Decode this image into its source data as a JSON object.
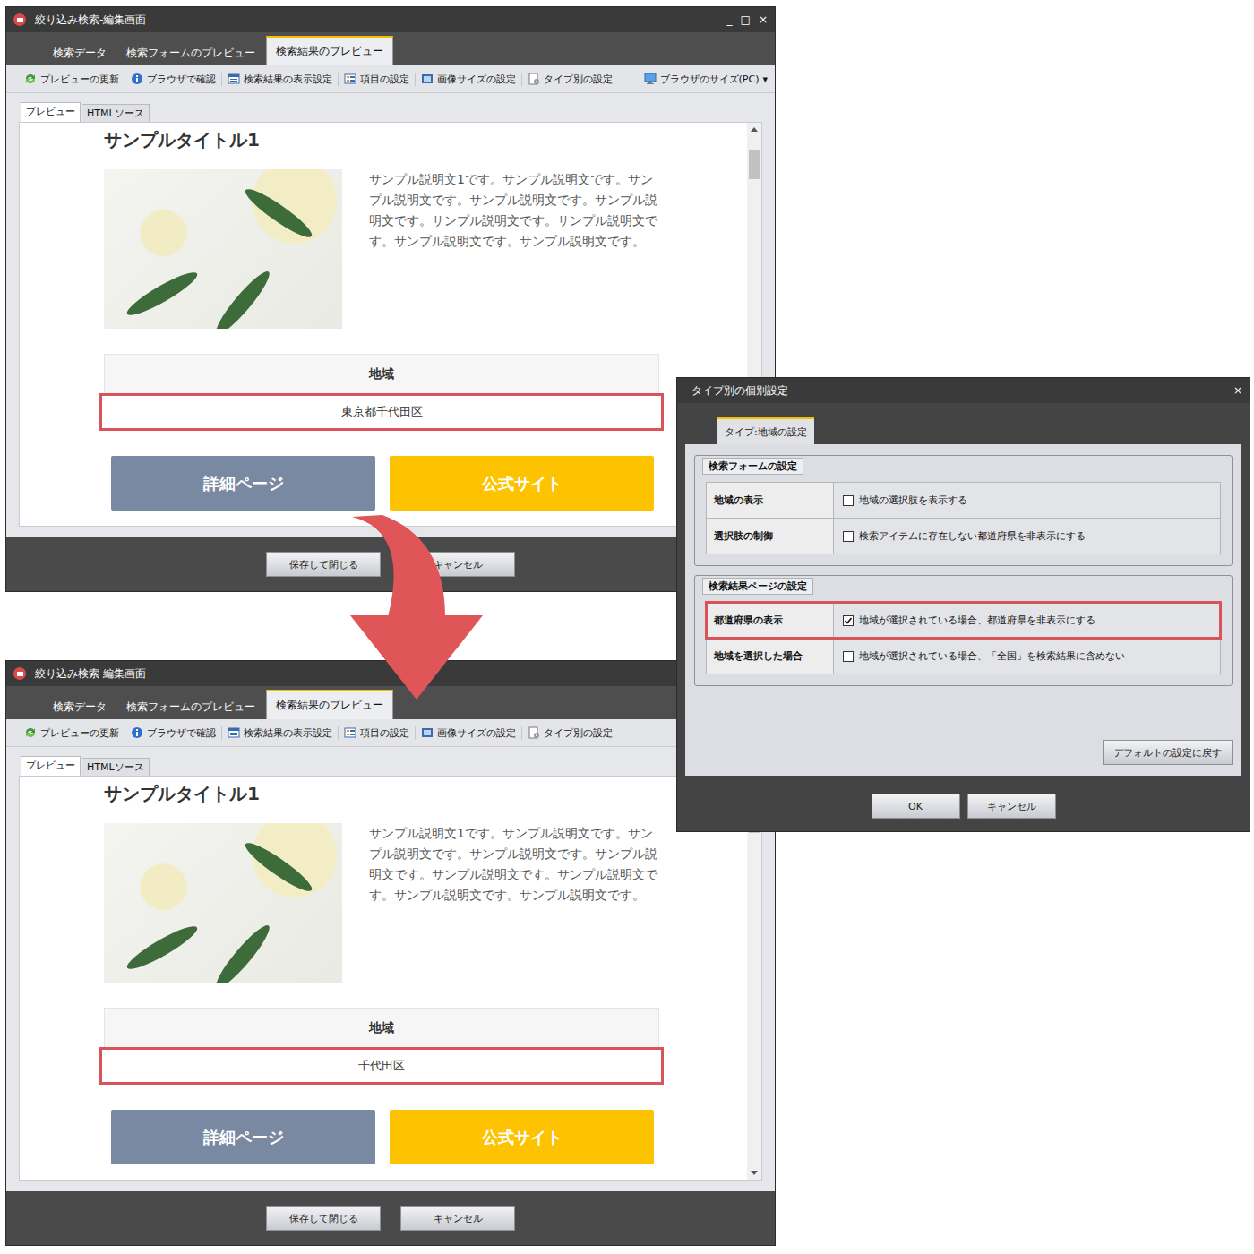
{
  "windows": [
    {
      "title": "絞り込み検索-編集画面",
      "controls": [
        "_",
        "□",
        "×"
      ],
      "tabs": [
        {
          "label": "検索データ",
          "selected": false
        },
        {
          "label": "検索フォームのプレビュー",
          "selected": false
        },
        {
          "label": "検索結果のプレビュー",
          "selected": true
        }
      ],
      "toolbar": [
        {
          "label": "プレビューの更新"
        },
        {
          "label": "ブラウザで確認"
        },
        {
          "label": "検索結果の表示設定"
        },
        {
          "label": "項目の設定"
        },
        {
          "label": "画像サイズの設定"
        },
        {
          "label": "タイプ別の設定"
        },
        {
          "label": "ブラウザのサイズ(PC)",
          "dropdown": "▾"
        }
      ],
      "subtabs": [
        {
          "label": "プレビュー",
          "selected": true
        },
        {
          "label": "HTMLソース",
          "selected": false
        }
      ],
      "preview": {
        "title": "サンプルタイトル1",
        "description": "サンプル説明文1です。サンプル説明文です。サンプル説明文です。サンプル説明文です。サンプル説明文です。サンプル説明文です。サンプル説明文です。サンプル説明文です。サンプル説明文です。",
        "field_label": "地域",
        "field_value": "東京都千代田区",
        "field_highlighted": true,
        "buttons": [
          "詳細ページ",
          "公式サイト"
        ]
      },
      "scroll": 0,
      "footer_buttons": [
        "保存して閉じる",
        "キャンセル"
      ]
    },
    {
      "title": "絞り込み検索-編集画面",
      "controls": [
        "_",
        "□",
        "×"
      ],
      "tabs": [
        {
          "label": "検索データ",
          "selected": false
        },
        {
          "label": "検索フォームのプレビュー",
          "selected": false
        },
        {
          "label": "検索結果のプレビュー",
          "selected": true
        }
      ],
      "toolbar": [
        {
          "label": "プレビューの更新"
        },
        {
          "label": "ブラウザで確認"
        },
        {
          "label": "検索結果の表示設定"
        },
        {
          "label": "項目の設定"
        },
        {
          "label": "画像サイズの設定"
        },
        {
          "label": "タイプ別の設定"
        }
      ],
      "subtabs": [
        {
          "label": "プレビュー",
          "selected": true
        },
        {
          "label": "HTMLソース",
          "selected": false
        }
      ],
      "preview": {
        "title": "サンプルタイトル1",
        "description": "サンプル説明文1です。サンプル説明文です。サンプル説明文です。サンプル説明文です。サンプル説明文です。サンプル説明文です。サンプル説明文です。サンプル説明文です。サンプル説明文です。",
        "field_label": "地域",
        "field_value": "千代田区",
        "field_highlighted": true,
        "buttons": [
          "詳細ページ",
          "公式サイト"
        ]
      },
      "scroll": 0,
      "footer_buttons": [
        "保存して閉じる",
        "キャンセル"
      ]
    }
  ],
  "dialog": {
    "title": "タイプ別の個別設定",
    "close": "×",
    "tab": {
      "label": "タイプ:地域の設定",
      "selected": true
    },
    "groups": [
      {
        "legend": "検索フォームの設定",
        "rows": [
          {
            "label": "地域の表示",
            "option": "地域の選択肢を表示する",
            "checked": false,
            "highlighted": false
          },
          {
            "label": "選択肢の制御",
            "option": "検索アイテムに存在しない都道府県を非表示にする",
            "checked": false,
            "highlighted": false
          }
        ]
      },
      {
        "legend": "検索結果ページの設定",
        "rows": [
          {
            "label": "都道府県の表示",
            "option": "地域が選択されている場合、都道府県を非表示にする",
            "checked": true,
            "highlighted": true
          },
          {
            "label": "地域を選択した場合",
            "option": "地域が選択されている場合、「全国」を検索結果に含めない",
            "checked": false,
            "highlighted": false
          }
        ]
      }
    ],
    "reset_button": "デフォルトの設定に戻す",
    "buttons": [
      "OK",
      "キャンセル"
    ]
  }
}
